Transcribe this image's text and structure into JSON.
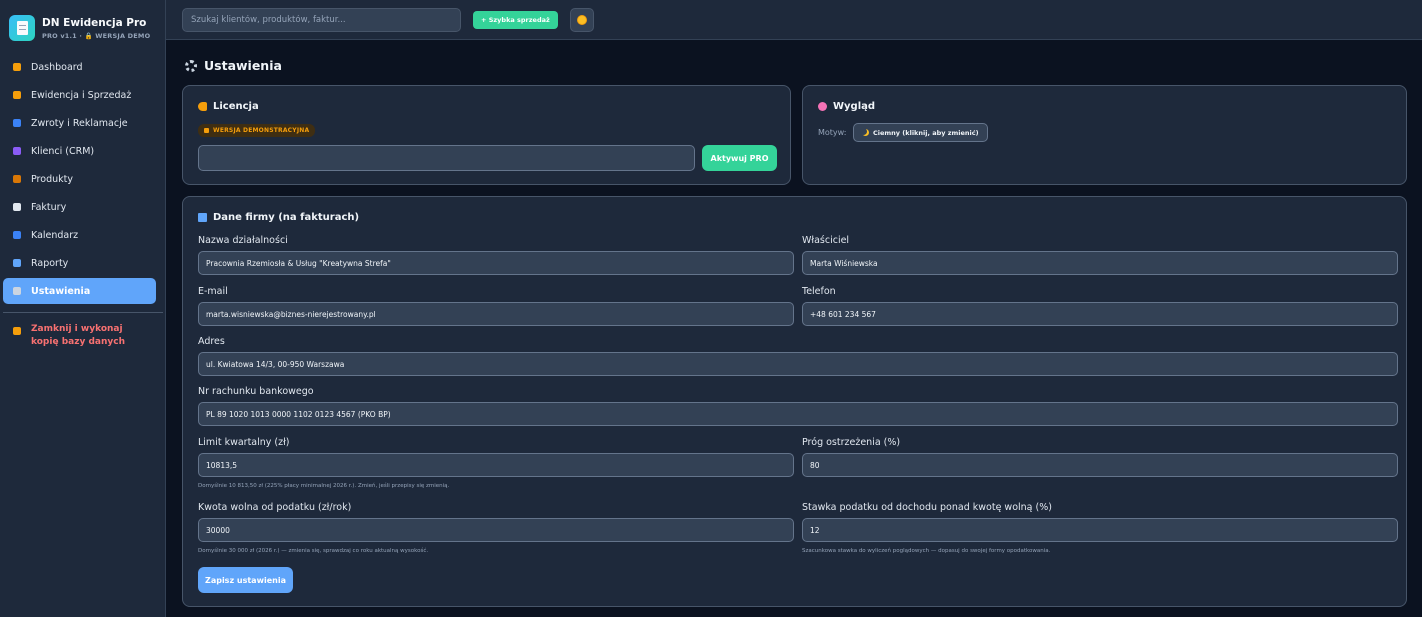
{
  "app": {
    "title": "DN Ewidencja Pro",
    "subtitle": "PRO v1.1 · 🔒 WERSJA DEMO"
  },
  "sidebar": {
    "items": [
      {
        "label": "Dashboard",
        "icon": "house-icon",
        "color": "#f59e0b"
      },
      {
        "label": "Ewidencja i Sprzedaż",
        "icon": "money-bag-icon",
        "color": "#f59e0b"
      },
      {
        "label": "Zwroty i Reklamacje",
        "icon": "return-arrows-icon",
        "color": "#3b82f6"
      },
      {
        "label": "Klienci (CRM)",
        "icon": "people-icon",
        "color": "#8b5cf6"
      },
      {
        "label": "Produkty",
        "icon": "package-icon",
        "color": "#d97706"
      },
      {
        "label": "Faktury",
        "icon": "document-icon",
        "color": "#e2e8f0"
      },
      {
        "label": "Kalendarz",
        "icon": "calendar-icon",
        "color": "#3b82f6"
      },
      {
        "label": "Raporty",
        "icon": "bar-chart-icon",
        "color": "#60a5fa"
      },
      {
        "label": "Ustawienia",
        "icon": "gear-icon",
        "color": "#cbd5e1",
        "active": true
      }
    ],
    "exit_label": "Zamknij i wykonaj kopię bazy danych",
    "exit_icon": "lock-icon"
  },
  "topbar": {
    "search_placeholder": "Szukaj klientów, produktów, faktur...",
    "quick_sale_label": "+ Szybka sprzedaż",
    "theme_icon": "sun-icon"
  },
  "page": {
    "title": "Ustawienia"
  },
  "license": {
    "title": "Licencja",
    "badge": "WERSJA DEMONSTRACYJNA",
    "key_value": "",
    "activate_label": "Aktywuj PRO"
  },
  "appearance": {
    "title": "Wygląd",
    "theme_label": "Motyw:",
    "theme_button": "Ciemny (kliknij, aby zmienić)"
  },
  "company": {
    "title": "Dane firmy (na fakturach)",
    "name_label": "Nazwa działalności",
    "name_value": "Pracownia Rzemiosła & Usług \"Kreatywna Strefa\"",
    "owner_label": "Właściciel",
    "owner_value": "Marta Wiśniewska",
    "email_label": "E-mail",
    "email_value": "marta.wisniewska@biznes-nierejestrowany.pl",
    "phone_label": "Telefon",
    "phone_value": "+48 601 234 567",
    "address_label": "Adres",
    "address_value": "ul. Kwiatowa 14/3, 00-950 Warszawa",
    "bank_label": "Nr rachunku bankowego",
    "bank_value": "PL 89 1020 1013 0000 1102 0123 4567 (PKO BP)",
    "limit_label": "Limit kwartalny (zł)",
    "limit_value": "10813,5",
    "limit_hint": "Domyślnie 10 813,50 zł (225% płacy minimalnej 2026 r.). Zmień, jeśli przepisy się zmienią.",
    "warning_label": "Próg ostrzeżenia (%)",
    "warning_value": "80",
    "free_label": "Kwota wolna od podatku (zł/rok)",
    "free_value": "30000",
    "free_hint": "Domyślnie 30 000 zł (2026 r.) — zmienia się, sprawdzaj co roku aktualną wysokość.",
    "tax_label": "Stawka podatku od dochodu ponad kwotę wolną (%)",
    "tax_value": "12",
    "tax_hint": "Szacunkowa stawka do wyliczeń poglądowych — dopasuj do swojej formy opodatkowania.",
    "save_label": "Zapisz ustawienia"
  }
}
